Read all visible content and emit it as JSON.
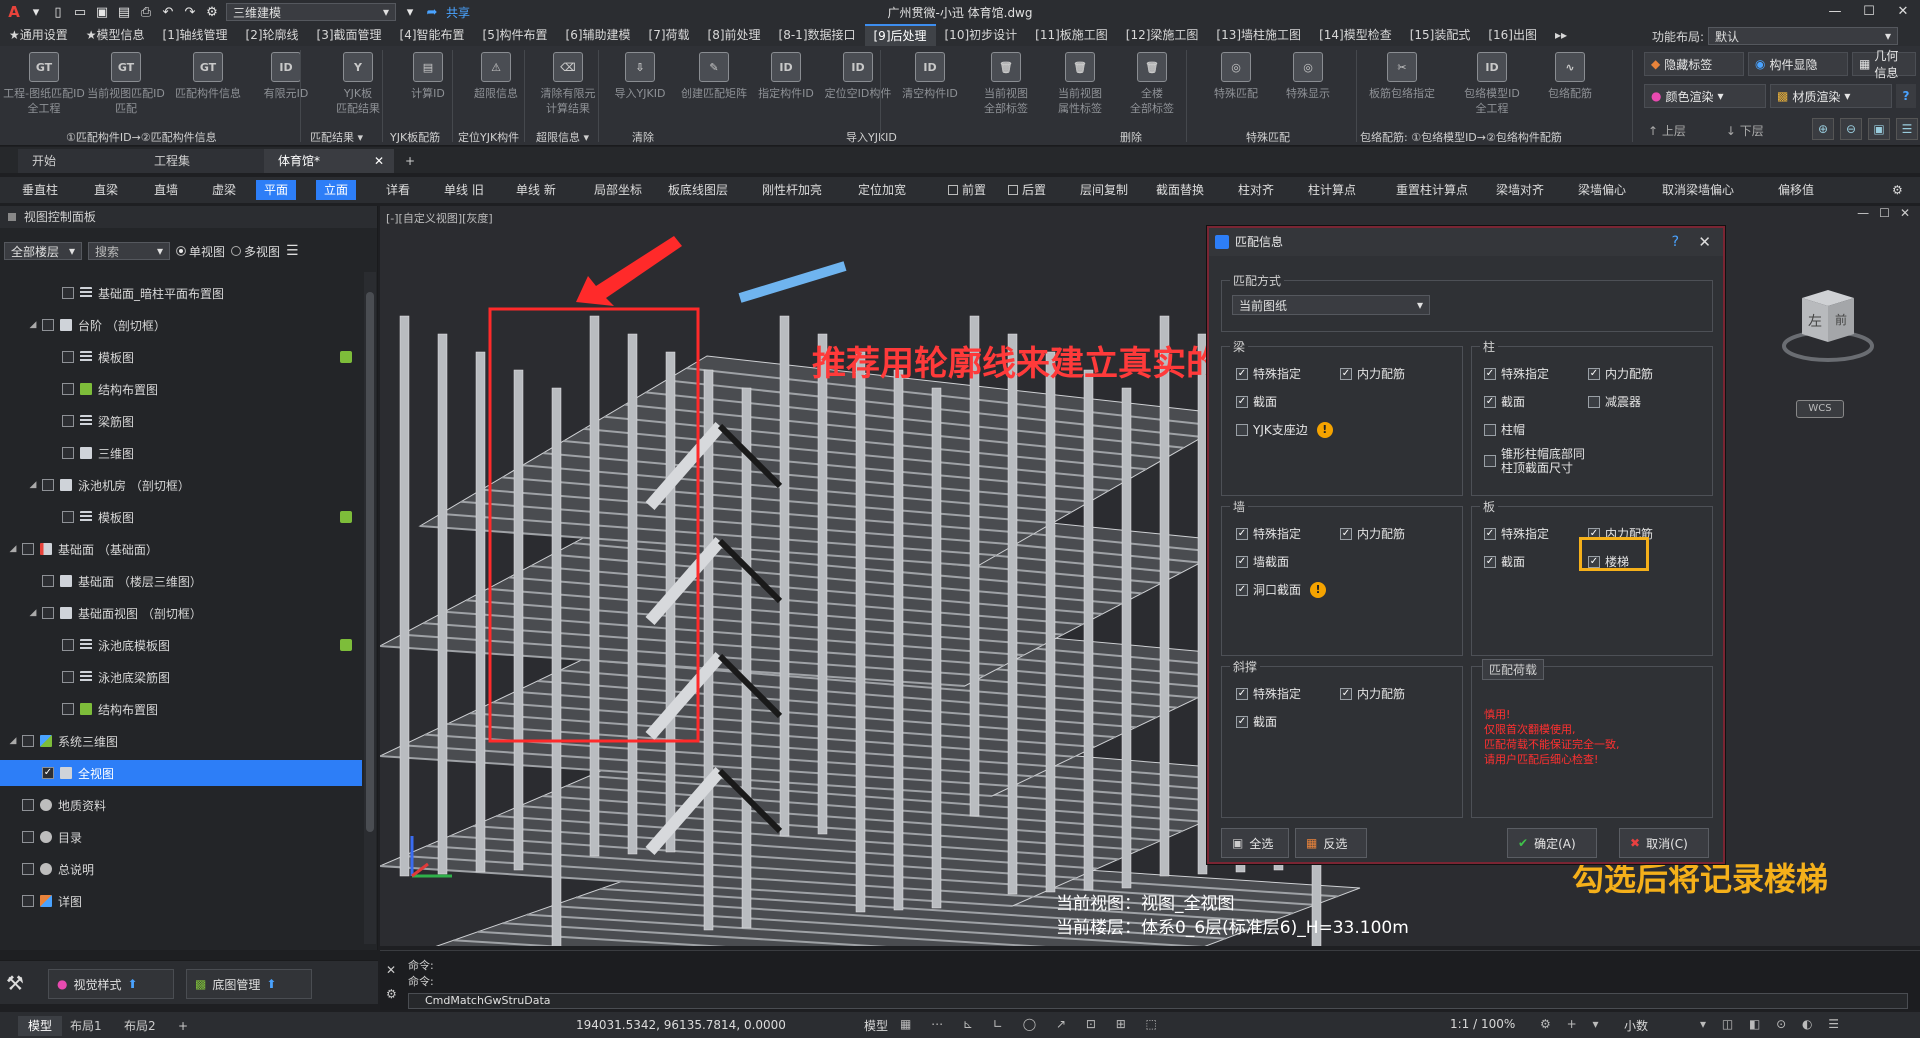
{
  "titlebar": {
    "logo": "A",
    "workspace": "三维建模",
    "share": "共享",
    "window_title": "广州贯微-小迅    体育馆.dwg",
    "controls": [
      "—",
      "☐",
      "✕"
    ]
  },
  "menubar": {
    "tabs": [
      "★通用设置",
      "★模型信息",
      "[1]轴线管理",
      "[2]轮廓线",
      "[3]截面管理",
      "[4]智能布置",
      "[5]构件布置",
      "[6]辅助建模",
      "[7]荷载",
      "[8]前处理",
      "[8-1]数据接口",
      "[9]后处理",
      "[10]初步设计",
      "[11]板施工图",
      "[12]梁施工图",
      "[13]墙柱施工图",
      "[14]模型检查",
      "[15]装配式",
      "[16]出图"
    ],
    "active_index": 11,
    "more": "▸▸",
    "layout_label": "功能布局:",
    "layout_value": "默认"
  },
  "ribbon": {
    "buttons": [
      {
        "icon": "GT",
        "label": "工程-图纸匹配ID\n全工程"
      },
      {
        "icon": "GT",
        "label": "当前视图匹配ID\n匹配"
      },
      {
        "icon": "GT",
        "label": "匹配构件信息"
      },
      {
        "icon": "ID",
        "label": "有限元ID"
      },
      {
        "icon": "Y",
        "label": "YJK板\n匹配结果"
      },
      {
        "icon": "▤",
        "label": "计算ID"
      },
      {
        "icon": "⚠",
        "label": "超限信息"
      },
      {
        "icon": "⌫",
        "label": "清除有限元\n计算结果"
      },
      {
        "icon": "⇩",
        "label": "导入YJKID"
      },
      {
        "icon": "✎",
        "label": "创建匹配矩阵"
      },
      {
        "icon": "ID",
        "label": "指定构件ID"
      },
      {
        "icon": "ID",
        "label": "定位空ID构件"
      },
      {
        "icon": "ID",
        "label": "清空构件ID"
      },
      {
        "icon": "🗑",
        "label": "当前视图\n全部标签"
      },
      {
        "icon": "🗑",
        "label": "当前视图\n属性标签"
      },
      {
        "icon": "🗑",
        "label": "全楼\n全部标签"
      },
      {
        "icon": "◎",
        "label": "特殊匹配"
      },
      {
        "icon": "◎",
        "label": "特殊显示"
      },
      {
        "icon": "✂",
        "label": "板筋包络指定"
      },
      {
        "icon": "ID",
        "label": "包络模型ID\n全工程"
      },
      {
        "icon": "∿",
        "label": "包络配筋"
      }
    ],
    "groups": [
      "①匹配构件ID→②匹配构件信息",
      "匹配结果 ▾",
      "YJK板配筋",
      "定位YJK构件",
      "超限信息 ▾",
      "清除",
      "导入YJKID",
      "删除",
      "特殊匹配",
      "包络配筋: ①包络模型ID→②包络构件配筋"
    ],
    "right": {
      "hide_label": "隐藏标签",
      "component_display": "构件显隐",
      "geometry_info": "几何信息",
      "color_render": "颜色渲染",
      "material_render": "材质渲染",
      "up_floor": "上层",
      "down_floor": "下层"
    }
  },
  "doctabs": {
    "tabs": [
      "开始",
      "工程集",
      "体育馆*"
    ],
    "add": "+",
    "close": "✕"
  },
  "toolbar2": {
    "items": [
      "垂直柱",
      "直梁",
      "直墙",
      "虚梁",
      "平面",
      "立面",
      "详看",
      "单线 旧",
      "单线 新",
      "局部坐标",
      "板底线图层",
      "刚性杆加亮",
      "定位加宽",
      "前置",
      "后置",
      "层间复制",
      "截面替换",
      "柱对齐",
      "柱计算点",
      "重置柱计算点",
      "梁墙对齐",
      "梁墙偏心",
      "取消梁墙偏心",
      "偏移值"
    ]
  },
  "leftpanel": {
    "title": "视图控制面板",
    "floor_select": "全部楼层",
    "search_placeholder": "搜索",
    "single_view": "单视图",
    "multi_view": "多视图",
    "tree": [
      {
        "label": "基础面_暗柱平面布置图",
        "level": 3,
        "icon": "bars",
        "arrow": ""
      },
      {
        "label": "台阶 （剖切框）",
        "level": 2,
        "icon": "grid",
        "arrow": "◢"
      },
      {
        "label": "模板图",
        "level": 3,
        "icon": "bars",
        "arrow": "",
        "badge": true
      },
      {
        "label": "结构布置图",
        "level": 3,
        "icon": "g",
        "arrow": ""
      },
      {
        "label": "梁筋图",
        "level": 3,
        "icon": "bars",
        "arrow": ""
      },
      {
        "label": "三维图",
        "level": 3,
        "icon": "cube",
        "arrow": ""
      },
      {
        "label": "泳池机房 （剖切框）",
        "level": 2,
        "icon": "grid",
        "arrow": "◢"
      },
      {
        "label": "模板图",
        "level": 3,
        "icon": "bars",
        "arrow": "",
        "badge": true
      },
      {
        "label": "基础面 （基础面）",
        "level": 1,
        "icon": "red",
        "arrow": "◢"
      },
      {
        "label": "基础面 （楼层三维图）",
        "level": 2,
        "icon": "grid",
        "arrow": ""
      },
      {
        "label": "基础面视图 （剖切框）",
        "level": 2,
        "icon": "grid",
        "arrow": "◢"
      },
      {
        "label": "泳池底模板图",
        "level": 3,
        "icon": "bars",
        "arrow": "",
        "badge": true
      },
      {
        "label": "泳池底梁筋图",
        "level": 3,
        "icon": "bars",
        "arrow": ""
      },
      {
        "label": "结构布置图",
        "level": 3,
        "icon": "g",
        "arrow": ""
      },
      {
        "label": "系统三维图",
        "level": 1,
        "icon": "sys",
        "arrow": "◢"
      },
      {
        "label": "全视图",
        "level": 2,
        "icon": "grid",
        "arrow": "",
        "selected": true
      },
      {
        "label": "地质资料",
        "level": 1,
        "icon": "circle",
        "arrow": ""
      },
      {
        "label": "目录",
        "level": 1,
        "icon": "circle",
        "arrow": ""
      },
      {
        "label": "总说明",
        "level": 1,
        "icon": "circle",
        "arrow": ""
      },
      {
        "label": "详图",
        "level": 1,
        "icon": "sys2",
        "arrow": ""
      }
    ],
    "bottom": {
      "view_style": "视觉样式",
      "base_map": "底图管理"
    }
  },
  "viewport": {
    "label": "[-][自定义视图][灰度]",
    "ctrls": [
      "—",
      "☐",
      "✕"
    ],
    "cube_left": "左",
    "cube_front": "前",
    "wcs": "WCS",
    "info_line1": "当前视图：视图_全视图",
    "info_line2": "当前楼层：体系0_6层(标准层6)_H=33.100m",
    "annotation_red": "推荐用轮廓线来建立真实的楼梯",
    "annotation_yellow": "勾选后将记录楼梯"
  },
  "dialog": {
    "title": "匹配信息",
    "help": "?",
    "close": "✕",
    "match_mode_label": "匹配方式",
    "match_mode_value": "当前图纸",
    "beam": {
      "title": "梁",
      "special": "特殊指定",
      "force": "内力配筋",
      "section": "截面",
      "yjk": "YJK支座边"
    },
    "column": {
      "title": "柱",
      "special": "特殊指定",
      "force": "内力配筋",
      "section": "截面",
      "damper": "减震器",
      "cap": "柱帽",
      "cone": "锥形柱帽底部同\n柱顶截面尺寸"
    },
    "wall": {
      "title": "墙",
      "special": "特殊指定",
      "force": "内力配筋",
      "section": "墙截面",
      "opening": "洞口截面"
    },
    "slab": {
      "title": "板",
      "special": "特殊指定",
      "force": "内力配筋",
      "section": "截面",
      "stair": "楼梯"
    },
    "brace": {
      "title": "斜撑",
      "special": "特殊指定",
      "force": "内力配筋",
      "section": "截面"
    },
    "load": {
      "title": "匹配荷载",
      "note": "慎用!\n仅限首次翻模使用,\n匹配荷载不能保证完全一致,\n请用户匹配后细心检查!"
    },
    "buttons": {
      "select_all": "全选",
      "invert": "反选",
      "ok": "确定(A)",
      "cancel": "取消(C)"
    },
    "colors": {
      "frame": "#7a2533",
      "highlight": "#f5b01a"
    }
  },
  "command": {
    "line1": "命令:",
    "line2": "命令:",
    "input": "CmdMatchGwStruData"
  },
  "statusbar": {
    "tabs": [
      "模型",
      "布局1",
      "布局2",
      "+"
    ],
    "coords": "194031.5342, 96135.7814, 0.0000",
    "model": "模型",
    "scale": "1:1 / 100%",
    "units": "小数"
  }
}
